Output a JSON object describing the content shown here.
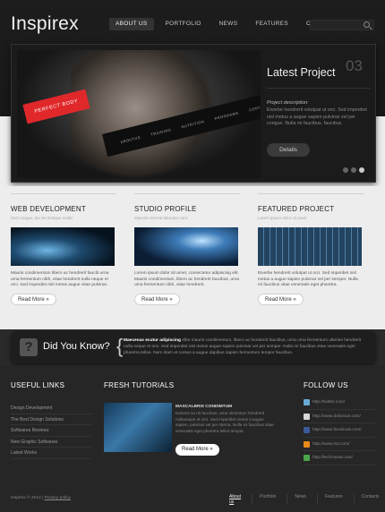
{
  "header": {
    "logo": "Inspirex",
    "nav": [
      "ABOUT US",
      "PORTFOLIO",
      "NEWS",
      "FEATURES",
      "CONTACTS"
    ],
    "active_nav": "ABOUT US"
  },
  "slider": {
    "badge": "PERFECT BODY",
    "strip_items": [
      "ABOUTUS",
      "TRAINING",
      "NUTRITION",
      "PROGRAMS",
      "CONTACTS"
    ],
    "title": "Latest Project",
    "number": "03",
    "subtitle": "Project description:",
    "text": "Eiverbe hendrerit volutpat ut orci. Sed imperdiet nisl metus a augue sapien pulvinar vel per congue. Nulla mi faucibus. faucibus.",
    "button": "Details",
    "dots": 3,
    "active_dot": 2
  },
  "columns": [
    {
      "title": "WEB DEVELOPMENT",
      "sub": "Sed congue, dui vel tristique mollis",
      "text": "Mauris condimentum libero ac hendrerit faucib urna urna fermentum nibh, vitae hendrerit nulla neque et orci. Sed imperdiet nisl metus augue vitae pulvinar.",
      "button": "Read More »",
      "thumb_color": "#1e4a6e"
    },
    {
      "title": "STUDIO PROFILE",
      "sub": "Maecila viverrat laborate nunc",
      "text": "Lorem ipsum dolor sit amet, consectetur adipiscing elit. Mauris condimentum, libero ac hendrerit faucibus, urna urna fermentum nibh, vitae hendrerit.",
      "button": "Read More »",
      "thumb_color": "#1a3d66"
    },
    {
      "title": "FEATURED PROJECT",
      "sub": "Lorem ipsum dolor sit amet",
      "text": "Eiverbe hendrerit volutpat ut orci. Sed imperdiet nisl metus a augue sapien pulvinar vel per semper. Nulla mi faucibus vitae venenatis eget pharetra.",
      "button": "Read More »",
      "thumb_color": "#2b4d6e"
    }
  ],
  "did_you_know": {
    "title": "Did You Know?",
    "bold": "Maecenas ecutur adipiscing",
    "text": "elbe mauris condimentum, libero ac hendrerit faucibus, urna urna fermentum ulteries hendrerit nulla neque et orci. Sed imperdiet nisl metus augue sapien pulvinar vel per semper. Nulla mi faucibus vitae venenatis eget pharetra tellus. Nam diam at cursus a augue dapibus sapien fermentum tempor faucibus."
  },
  "footer": {
    "useful_links_title": "USEFUL LINKS",
    "useful_links": [
      "Design Development",
      "The Best Design Solutions",
      "Softwares Reviews",
      "New Graphic Softwares",
      "Latest Works"
    ],
    "tutorials_title": "FRESH TUTORIALS",
    "tutorial_head": "MASCALBRIS CONDIMTUM",
    "tutorial_text": "Dolores sa nit faucibus, urna ulmentum hendrerit nullaneque et orci. Sed imperdiet metus a augue sapien. pulvinar vel per sterna. Nulla mi faucibus vitae venenatis eget pharetra tellus tempor.",
    "tutorial_button": "Read More »",
    "follow_title": "FOLLOW US",
    "social": [
      {
        "label": "http://twitter.com/",
        "color": "#6aa9d6"
      },
      {
        "label": "http://www.delicious.com/",
        "color": "#d8d8d8"
      },
      {
        "label": "http://www.facebook.com/",
        "color": "#3b5998"
      },
      {
        "label": "http://www.rss.com/",
        "color": "#e88a1a"
      },
      {
        "label": "http://technorati.com/",
        "color": "#4aa54a"
      }
    ],
    "copyright": "Inspirex © 2012 |",
    "privacy": "Privacy policy",
    "bottom_nav": [
      "About us",
      "Portfolio",
      "News",
      "Features",
      "Contacts"
    ],
    "active_bottom": "About us"
  }
}
